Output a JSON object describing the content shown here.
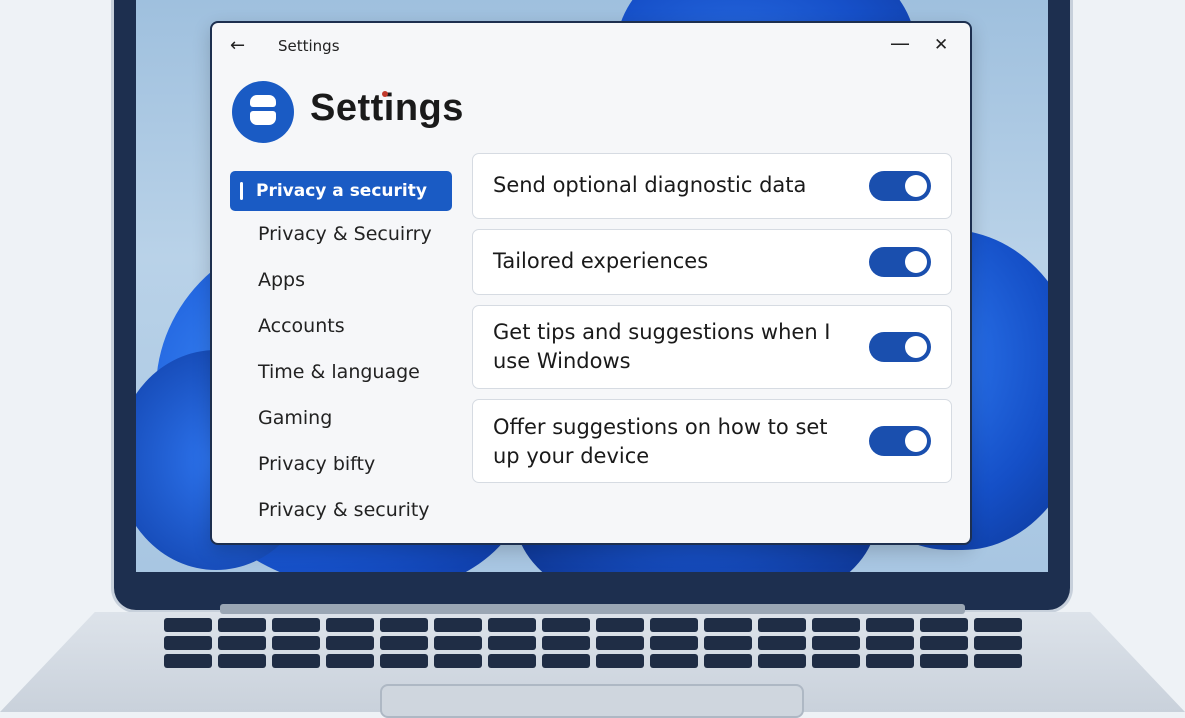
{
  "window": {
    "titlebar_title": "Settings",
    "heading": "Settings"
  },
  "icons": {
    "back": "back-arrow-icon",
    "minimize": "minimize-icon",
    "close": "close-icon",
    "logo": "user-account-icon"
  },
  "sidebar": {
    "items": [
      {
        "label": "Privacy a security",
        "active": true
      },
      {
        "label": "Privacy & Secuirry",
        "active": false
      },
      {
        "label": "Apps",
        "active": false
      },
      {
        "label": "Accounts",
        "active": false
      },
      {
        "label": "Time & language",
        "active": false
      },
      {
        "label": "Gaming",
        "active": false
      },
      {
        "label": "Privacy bifty",
        "active": false
      },
      {
        "label": "Privacy & security",
        "active": false
      }
    ]
  },
  "settings": [
    {
      "label": "Send optional diagnostic data",
      "enabled": true
    },
    {
      "label": "Tailored experiences",
      "enabled": true
    },
    {
      "label": "Get tips and suggestions when I use Windows",
      "enabled": true
    },
    {
      "label": "Offer suggestions on how to set up your device",
      "enabled": true
    }
  ],
  "colors": {
    "accent": "#1a5bc4",
    "toggle_on": "#1a4fae",
    "laptop_bezel": "#1d2f4f"
  }
}
